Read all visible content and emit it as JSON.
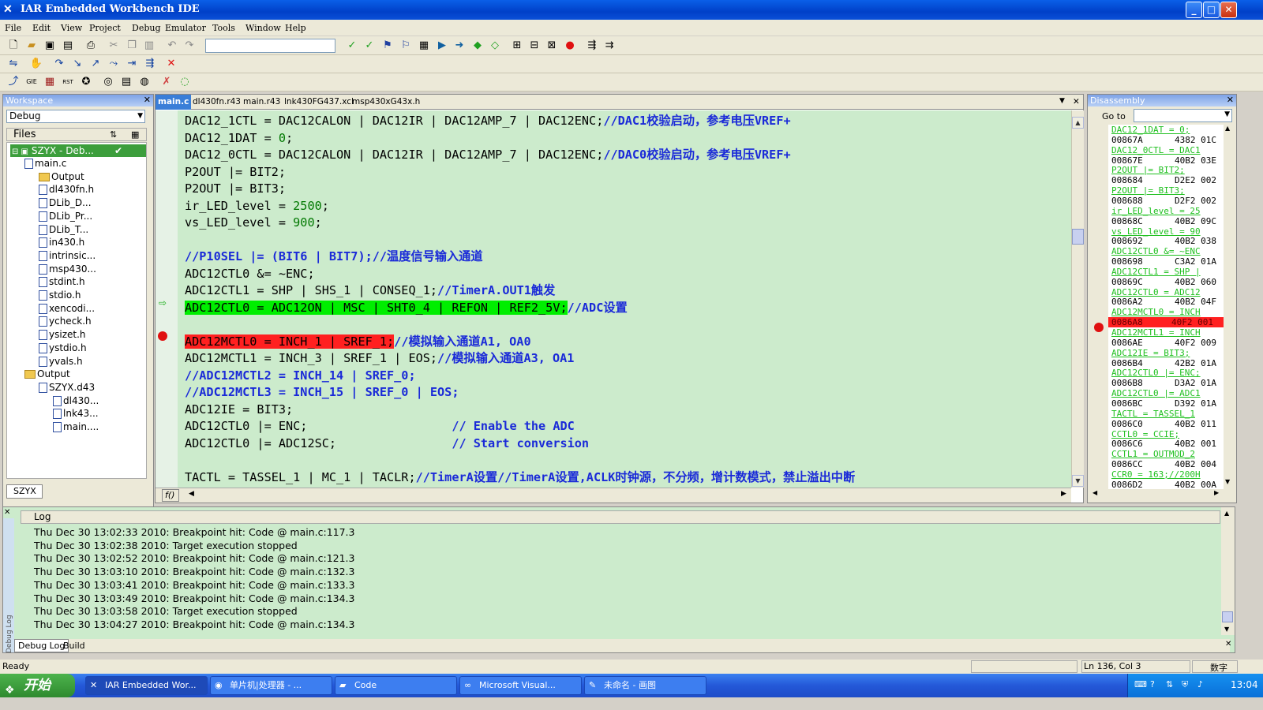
{
  "window": {
    "title": "IAR Embedded Workbench IDE",
    "min": "_",
    "max": "□",
    "close": "✕"
  },
  "menu": [
    "File",
    "Edit",
    "View",
    "Project",
    "Debug",
    "Emulator",
    "Tools",
    "Window",
    "Help"
  ],
  "workspace": {
    "title": "Workspace",
    "config": "Debug",
    "files_header": "Files",
    "project": "SZYX - Deb...",
    "tree": [
      {
        "label": "main.c",
        "level": 1,
        "type": "file"
      },
      {
        "label": "Output",
        "level": 2,
        "type": "folder"
      },
      {
        "label": "dl430fn.h",
        "level": 2,
        "type": "file"
      },
      {
        "label": "DLib_D...",
        "level": 2,
        "type": "file"
      },
      {
        "label": "DLib_Pr...",
        "level": 2,
        "type": "file"
      },
      {
        "label": "DLib_T...",
        "level": 2,
        "type": "file"
      },
      {
        "label": "in430.h",
        "level": 2,
        "type": "file"
      },
      {
        "label": "intrinsic...",
        "level": 2,
        "type": "file"
      },
      {
        "label": "msp430...",
        "level": 2,
        "type": "file"
      },
      {
        "label": "stdint.h",
        "level": 2,
        "type": "file"
      },
      {
        "label": "stdio.h",
        "level": 2,
        "type": "file"
      },
      {
        "label": "xencodi...",
        "level": 2,
        "type": "file"
      },
      {
        "label": "ycheck.h",
        "level": 2,
        "type": "file"
      },
      {
        "label": "ysizet.h",
        "level": 2,
        "type": "file"
      },
      {
        "label": "ystdio.h",
        "level": 2,
        "type": "file"
      },
      {
        "label": "yvals.h",
        "level": 2,
        "type": "file"
      },
      {
        "label": "Output",
        "level": 1,
        "type": "folder"
      },
      {
        "label": "SZYX.d43",
        "level": 2,
        "type": "file"
      },
      {
        "label": "dl430...",
        "level": 3,
        "type": "file"
      },
      {
        "label": "lnk43...",
        "level": 3,
        "type": "file"
      },
      {
        "label": "main....",
        "level": 3,
        "type": "file"
      }
    ],
    "tab": "SZYX"
  },
  "editor": {
    "tabs": [
      "main.c",
      "dl430fn.r43",
      "main.r43",
      "lnk430FG437.xcl",
      "msp430xG43x.h"
    ],
    "func_box": "f()",
    "lines": [
      {
        "code": "DAC12_1CTL = DAC12CALON | DAC12IR | DAC12AMP_7 | DAC12ENC;",
        "comment": "//DAC1校验启动，参考电压VREF+"
      },
      {
        "code": "DAC12_1DAT = ",
        "num": "0",
        "tail": ";"
      },
      {
        "code": "DAC12_0CTL = DAC12CALON | DAC12IR | DAC12AMP_7 | DAC12ENC;",
        "comment": "//DAC0校验启动，参考电压VREF+"
      },
      {
        "code": "P2OUT |= BIT2;"
      },
      {
        "code": "P2OUT |= BIT3;"
      },
      {
        "code": "ir_LED_level = ",
        "num": "2500",
        "tail": ";"
      },
      {
        "code": "vs_LED_level = ",
        "num": "900",
        "tail": ";"
      },
      {
        "code": ""
      },
      {
        "code": "",
        "comment": "//P10SEL |= (BIT6 | BIT7);//温度信号输入通道"
      },
      {
        "code": "ADC12CTL0 &= ~ENC;"
      },
      {
        "code": "ADC12CTL1 = SHP | SHS_1 | CONSEQ_1;",
        "comment": "//TimerA.OUT1触发"
      },
      {
        "code": "ADC12CTL0 = ADC12ON | MSC | SHT0_4 | REFON | REF2_5V;",
        "comment": "//ADC设置",
        "hl": "green"
      },
      {
        "code": ""
      },
      {
        "code": "ADC12MCTL0 = INCH_1 | SREF_1;",
        "comment": "//模拟输入通道A1, OA0",
        "hl": "red"
      },
      {
        "code": "ADC12MCTL1 = INCH_3 | SREF_1 | EOS;",
        "comment": "//模拟输入通道A3, OA1"
      },
      {
        "code": "",
        "comment": "//ADC12MCTL2 = INCH_14 | SREF_0;"
      },
      {
        "code": "",
        "comment": "//ADC12MCTL3 = INCH_15 | SREF_0 | EOS;"
      },
      {
        "code": "ADC12IE = BIT3;"
      },
      {
        "code": "ADC12CTL0 |= ENC;                    ",
        "comment": "// Enable the ADC"
      },
      {
        "code": "ADC12CTL0 |= ADC12SC;                ",
        "comment": "// Start conversion"
      },
      {
        "code": ""
      },
      {
        "code": "TACTL = TASSEL_1 | MC_1 | TACLR;",
        "comment": "//TimerA设置//TimerA设置,ACLK时钟源，不分频，增计数模式，禁止溢出中断"
      }
    ]
  },
  "disassembly": {
    "title": "Disassembly",
    "goto_label": "Go to",
    "lines": [
      {
        "src": "DAC12_1DAT = 0;"
      },
      {
        "addr": "00867A",
        "bytes": "4382 01C"
      },
      {
        "src": "DAC12_0CTL = DAC1"
      },
      {
        "addr": "00867E",
        "bytes": "40B2 03E"
      },
      {
        "src": "P2OUT |= BIT2;"
      },
      {
        "addr": "008684",
        "bytes": "D2E2 002"
      },
      {
        "src": "P2OUT |= BIT3;"
      },
      {
        "addr": "008688",
        "bytes": "D2F2 002"
      },
      {
        "src": "ir_LED_level = 25"
      },
      {
        "addr": "00868C",
        "bytes": "40B2 09C"
      },
      {
        "src": "vs_LED_level = 90"
      },
      {
        "addr": "008692",
        "bytes": "40B2 038"
      },
      {
        "src": "ADC12CTL0 &= ~ENC"
      },
      {
        "addr": "008698",
        "bytes": "C3A2 01A"
      },
      {
        "src": "ADC12CTL1 = SHP |"
      },
      {
        "addr": "00869C",
        "bytes": "40B2 060"
      },
      {
        "src": "ADC12CTL0 = ADC12"
      },
      {
        "addr": "0086A2",
        "bytes": "40B2 04F"
      },
      {
        "src": "ADC12MCTL0 = INCH"
      },
      {
        "addr": "0086A8",
        "bytes": "40F2 001",
        "hl": true
      },
      {
        "src": "ADC12MCTL1 = INCH"
      },
      {
        "addr": "0086AE",
        "bytes": "40F2 009"
      },
      {
        "src": "ADC12IE = BIT3;"
      },
      {
        "addr": "0086B4",
        "bytes": "42B2 01A"
      },
      {
        "src": "ADC12CTL0 |= ENC;"
      },
      {
        "addr": "0086B8",
        "bytes": "D3A2 01A"
      },
      {
        "src": "ADC12CTL0 |= ADC1"
      },
      {
        "addr": "0086BC",
        "bytes": "D392 01A"
      },
      {
        "src": "TACTL = TASSEL_1"
      },
      {
        "addr": "0086C0",
        "bytes": "40B2 011"
      },
      {
        "src": "CCTL0 = CCIE;"
      },
      {
        "addr": "0086C6",
        "bytes": "40B2 001"
      },
      {
        "src": "CCTL1 = OUTMOD_2"
      },
      {
        "addr": "0086CC",
        "bytes": "40B2 004"
      },
      {
        "src": "CCR0 = 163;//200H"
      },
      {
        "addr": "0086D2",
        "bytes": "40B2 00A"
      }
    ]
  },
  "log": {
    "header": "Log",
    "lines": [
      "Thu Dec 30 13:02:33 2010: Breakpoint hit: Code @ main.c:117.3",
      "Thu Dec 30 13:02:38 2010: Target execution stopped",
      "Thu Dec 30 13:02:52 2010: Breakpoint hit: Code @ main.c:121.3",
      "Thu Dec 30 13:03:10 2010: Breakpoint hit: Code @ main.c:132.3",
      "Thu Dec 30 13:03:41 2010: Breakpoint hit: Code @ main.c:133.3",
      "Thu Dec 30 13:03:49 2010: Breakpoint hit: Code @ main.c:134.3",
      "Thu Dec 30 13:03:58 2010: Target execution stopped",
      "Thu Dec 30 13:04:27 2010: Breakpoint hit: Code @ main.c:134.3"
    ],
    "tabs": [
      "Debug Log",
      "Build"
    ],
    "side_label": "Debug Log"
  },
  "status": {
    "left": "Ready",
    "pos": "Ln 136, Col 3",
    "mode": "数字"
  },
  "taskbar": {
    "start": "开始",
    "tasks": [
      "IAR Embedded Wor...",
      "单片机|处理器 - ...",
      "Code",
      "Microsoft Visual...",
      "未命名 - 画图"
    ],
    "clock": "13:04"
  }
}
